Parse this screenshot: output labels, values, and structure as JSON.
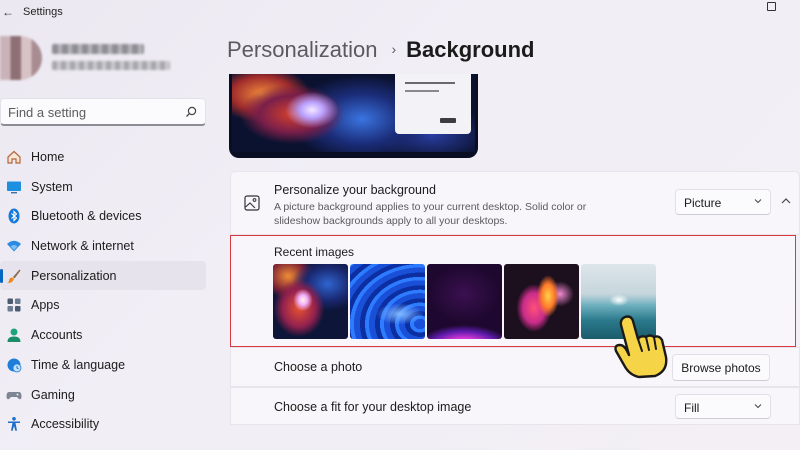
{
  "window": {
    "title": "Settings"
  },
  "search": {
    "placeholder": "Find a setting"
  },
  "nav": {
    "items": [
      {
        "label": "Home"
      },
      {
        "label": "System"
      },
      {
        "label": "Bluetooth & devices"
      },
      {
        "label": "Network & internet"
      },
      {
        "label": "Personalization"
      },
      {
        "label": "Apps"
      },
      {
        "label": "Accounts"
      },
      {
        "label": "Time & language"
      },
      {
        "label": "Gaming"
      },
      {
        "label": "Accessibility"
      }
    ],
    "active_index": 4
  },
  "breadcrumb": {
    "parent": "Personalization",
    "separator": "›",
    "current": "Background"
  },
  "background_card": {
    "title": "Personalize your background",
    "description": "A picture background applies to your current desktop. Solid color or slideshow backgrounds apply to all your desktops.",
    "selected_type": "Picture"
  },
  "recent_images": {
    "label": "Recent images",
    "count": 5
  },
  "choose_photo": {
    "label": "Choose a photo",
    "button_label": "Browse photos"
  },
  "choose_fit": {
    "label": "Choose a fit for your desktop image",
    "selected": "Fill"
  },
  "colors": {
    "accent": "#0067c0",
    "highlight_border": "#d9393f"
  }
}
